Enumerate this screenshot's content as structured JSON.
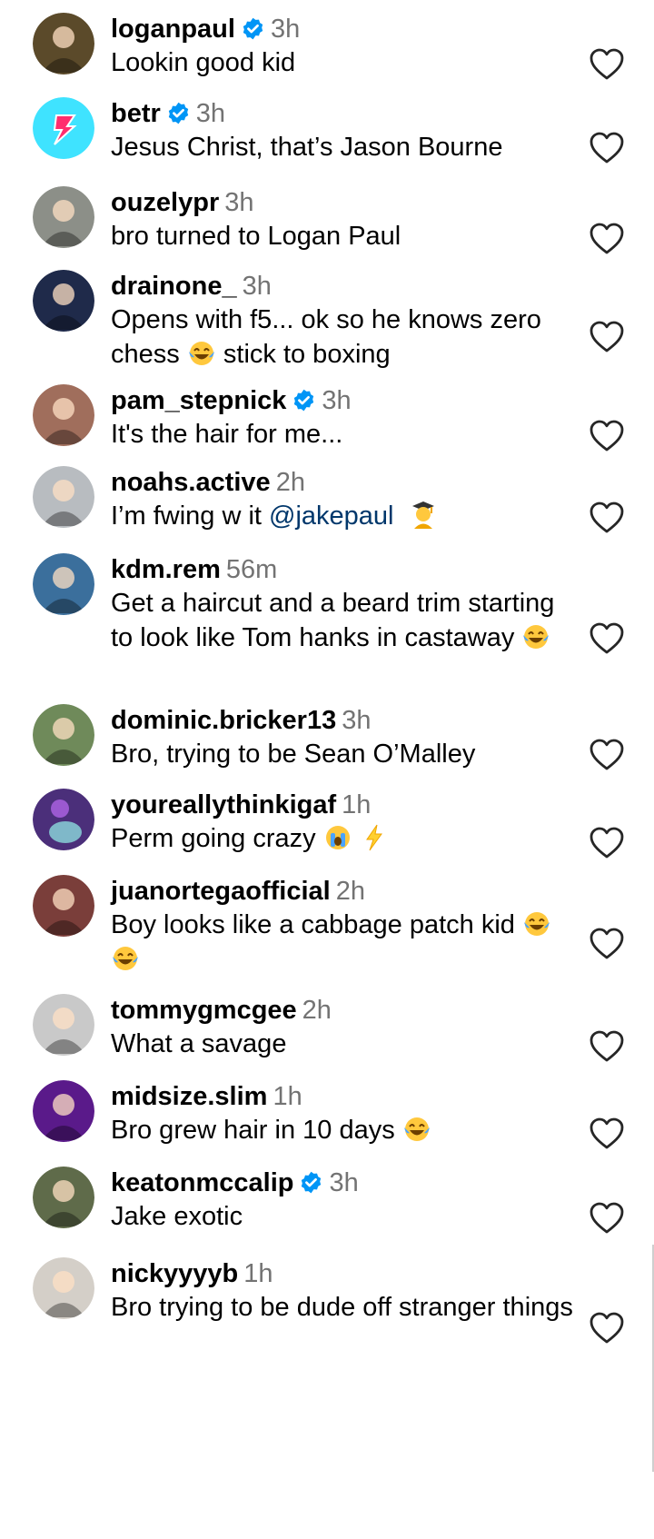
{
  "comments": [
    {
      "username": "loganpaul",
      "verified": true,
      "time": "3h",
      "text": "Lookin good kid",
      "emojis": [],
      "avatar_icon": "fighter-photo-avatar",
      "avatar_color": "#5b4a2a"
    },
    {
      "username": "betr",
      "verified": true,
      "time": "3h",
      "text": "Jesus Christ, that’s Jason Bourne",
      "emojis": [],
      "avatar_icon": "betr-lightning-logo",
      "avatar_color": "#3fe3ff"
    },
    {
      "username": "ouzelypr",
      "verified": false,
      "time": "3h",
      "text": "bro turned to Logan Paul",
      "emojis": [],
      "avatar_icon": "child-photo-avatar",
      "avatar_color": "#8c8f88"
    },
    {
      "username": "drainone_",
      "verified": false,
      "time": "3h",
      "text": "Opens with f5... ok so he knows zero chess",
      "text_after": " stick to boxing",
      "emojis": [
        "laughing-tears-emoji"
      ],
      "avatar_icon": "martial-artist-photo-avatar",
      "avatar_color": "#1f2a4a"
    },
    {
      "username": "pam_stepnick",
      "verified": true,
      "time": "3h",
      "text": "It's the hair for me...",
      "emojis": [],
      "avatar_icon": "group-photo-avatar",
      "avatar_color": "#a06e5c"
    },
    {
      "username": "noahs.active",
      "verified": false,
      "time": "2h",
      "text": "I’m fwing w it ",
      "mention": "@jakepaul",
      "emojis": [
        "man-teacher-emoji"
      ],
      "avatar_icon": "gym-photo-avatar",
      "avatar_color": "#b8bcc0"
    },
    {
      "username": "kdm.rem",
      "verified": false,
      "time": "56m",
      "text": "Get a haircut and a beard trim starting to look like Tom hanks in castaway",
      "emojis": [
        "laughing-tears-emoji"
      ],
      "avatar_icon": "car-photo-avatar",
      "avatar_color": "#3b6f9c"
    },
    {
      "username": "dominic.bricker13",
      "verified": false,
      "time": "3h",
      "text": "Bro, trying to be Sean O’Malley",
      "emojis": [],
      "avatar_icon": "family-photo-avatar",
      "avatar_color": "#6f8a5a"
    },
    {
      "username": "youreallythinkigaf",
      "verified": false,
      "time": "1h",
      "text": "Perm going crazy",
      "emojis": [
        "crying-face-emoji",
        "lightning-emoji"
      ],
      "avatar_icon": "purple-figure-avatar",
      "avatar_color": "#4b2f7a"
    },
    {
      "username": "juanortegaofficial",
      "verified": false,
      "time": "2h",
      "text": "Boy looks like a cabbage patch kid",
      "emojis": [
        "laughing-tears-emoji",
        "laughing-tears-emoji"
      ],
      "avatar_icon": "portrait-photo-avatar",
      "avatar_color": "#7a3e3a"
    },
    {
      "username": "tommygmcgee",
      "verified": false,
      "time": "2h",
      "text": "What a savage",
      "emojis": [],
      "avatar_icon": "bike-photo-avatar",
      "avatar_color": "#c9c9c9"
    },
    {
      "username": "midsize.slim",
      "verified": false,
      "time": "1h",
      "text": "Bro grew hair in 10 days",
      "emojis": [
        "laughing-tears-emoji"
      ],
      "avatar_icon": "neon-photo-avatar",
      "avatar_color": "#5a1a8a"
    },
    {
      "username": "keatonmccalip",
      "verified": true,
      "time": "3h",
      "text": "Jake exotic",
      "emojis": [],
      "avatar_icon": "cap-photo-avatar",
      "avatar_color": "#5f6b4a"
    },
    {
      "username": "nickyyyyb",
      "verified": false,
      "time": "1h",
      "text": "Bro trying to be dude off stranger things",
      "emojis": [],
      "avatar_icon": "selfie-photo-avatar",
      "avatar_color": "#d4cfc8"
    }
  ],
  "icons": {
    "like": "heart-outline-icon",
    "verified": "verified-badge-icon"
  },
  "colors": {
    "verified": "#0095f6",
    "timestamp": "#737373",
    "mention": "#00376b",
    "heart": "#262626"
  }
}
